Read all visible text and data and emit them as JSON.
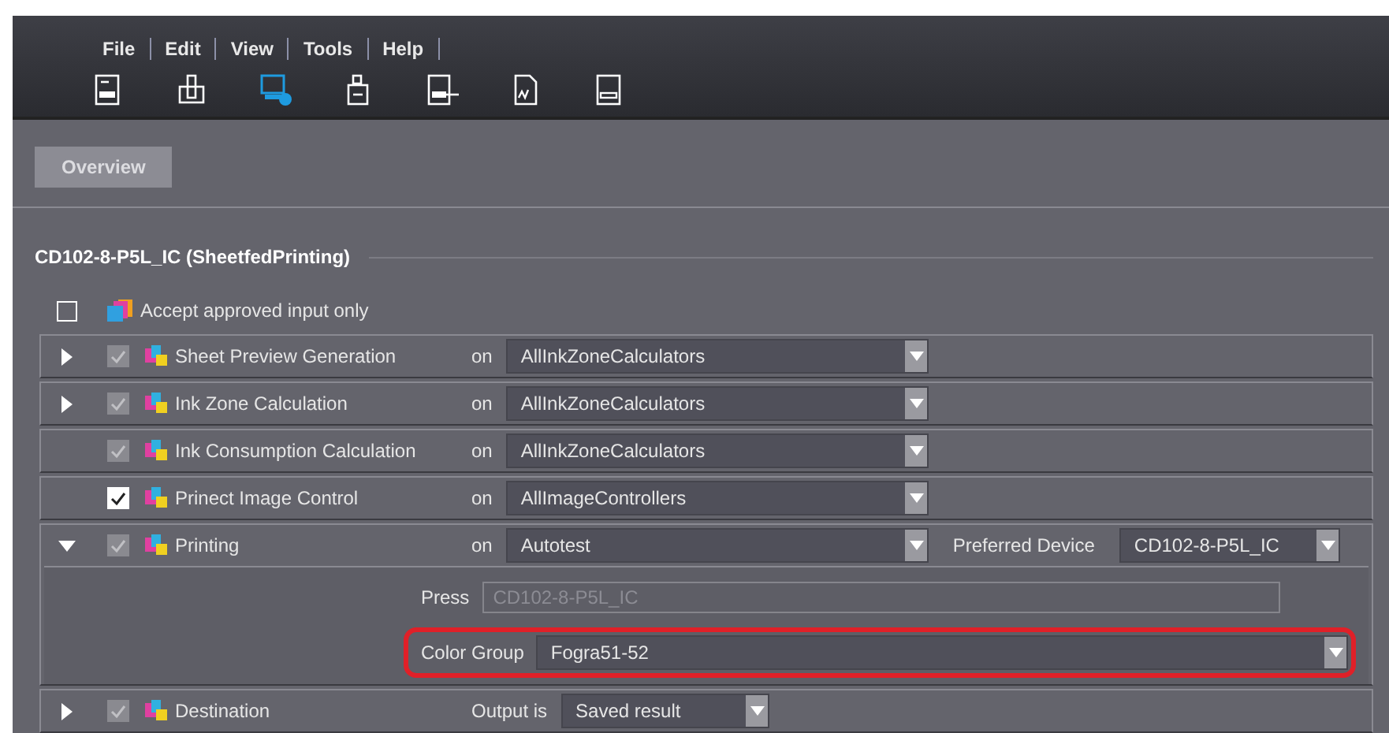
{
  "menu": [
    "File",
    "Edit",
    "View",
    "Tools",
    "Help"
  ],
  "toolbar": [
    {
      "kind": "abc-doc",
      "selected": false
    },
    {
      "kind": "press",
      "selected": false
    },
    {
      "kind": "monitor-gear",
      "selected": true
    },
    {
      "kind": "printer",
      "selected": false
    },
    {
      "kind": "abc-arrow",
      "selected": false
    },
    {
      "kind": "signature",
      "selected": false
    },
    {
      "kind": "chain-doc",
      "selected": false
    }
  ],
  "tabs": [
    {
      "label": "Overview",
      "selected": true
    }
  ],
  "section_title": "CD102-8-P5L_IC (SheetfedPrinting)",
  "accept": {
    "label": "Accept approved input only",
    "checked": false
  },
  "steps": [
    {
      "name": "Sheet Preview Generation",
      "expanded": false,
      "checked": true,
      "enabled": false,
      "connector": "on",
      "value": "AllInkZoneCalculators"
    },
    {
      "name": "Ink Zone Calculation",
      "expanded": false,
      "checked": true,
      "enabled": false,
      "connector": "on",
      "value": "AllInkZoneCalculators"
    },
    {
      "name": "Ink Consumption Calculation",
      "checked": true,
      "enabled": false,
      "connector": "on",
      "value": "AllInkZoneCalculators"
    },
    {
      "name": "Prinect Image Control",
      "checked": true,
      "enabled": true,
      "connector": "on",
      "value": "AllImageControllers"
    },
    {
      "name": "Printing",
      "expanded": true,
      "checked": true,
      "enabled": false,
      "connector": "on",
      "value": "Autotest",
      "extra_label": "Preferred Device",
      "extra_value": "CD102-8-P5L_IC",
      "details": [
        {
          "kind": "field",
          "label": "Press",
          "value": "CD102-8-P5L_IC",
          "highlighted": false
        },
        {
          "kind": "dropdown",
          "label": "Color Group",
          "value": "Fogra51-52",
          "highlighted": true
        }
      ]
    },
    {
      "name": "Destination",
      "expanded": false,
      "checked": true,
      "enabled": false,
      "connector": "Output is",
      "value": "Saved result",
      "narrow": true
    }
  ]
}
